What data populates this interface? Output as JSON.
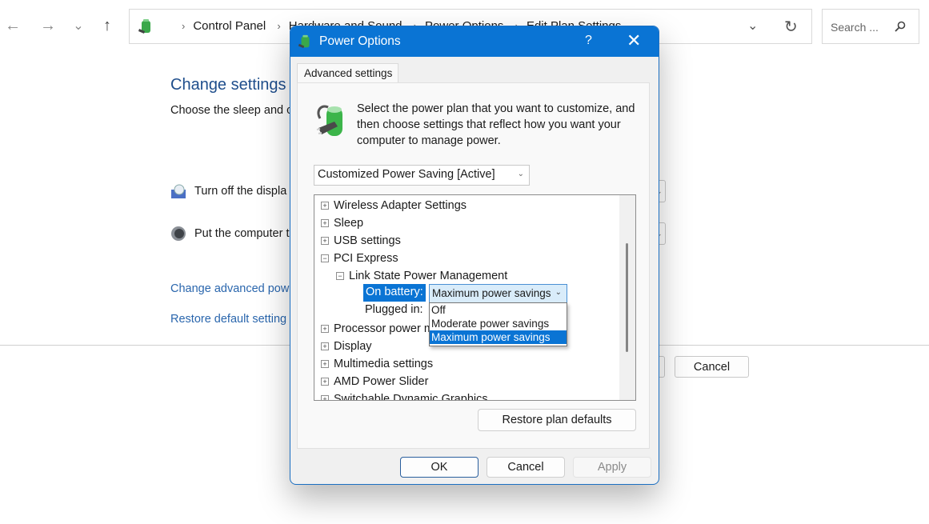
{
  "explorer": {
    "nav": {
      "back_icon": "←",
      "forward_icon": "→",
      "recent_icon": "⌄",
      "up_icon": "↑"
    },
    "breadcrumb": [
      "Control Panel",
      "Hardware and Sound",
      "Power Options",
      "Edit Plan Settings"
    ],
    "search_placeholder": "Search ...",
    "refresh_icon": "↻",
    "dropdown_icon": "⌄"
  },
  "page": {
    "title": "Change settings f",
    "subtitle": "Choose the sleep and c",
    "rows": [
      {
        "label": "Turn off the displa"
      },
      {
        "label": "Put the computer t"
      }
    ],
    "links": [
      "Change advanced pow",
      "Restore default setting"
    ],
    "cancel_label": "Cancel"
  },
  "dialog": {
    "title": "Power Options",
    "help_label": "?",
    "close_label": "✕",
    "tab_label": "Advanced settings",
    "description": "Select the power plan that you want to customize, and then choose settings that reflect how you want your computer to manage power.",
    "plan_select_value": "Customized Power Saving [Active]",
    "tree": {
      "items": [
        {
          "label": "Wireless Adapter Settings",
          "state": "+"
        },
        {
          "label": "Sleep",
          "state": "+"
        },
        {
          "label": "USB settings",
          "state": "+"
        },
        {
          "label": "PCI Express",
          "state": "−"
        },
        {
          "label": "Link State Power Management",
          "state": "−"
        },
        {
          "label": "Processor power management",
          "state": "+"
        },
        {
          "label": "Display",
          "state": "+"
        },
        {
          "label": "Multimedia settings",
          "state": "+"
        },
        {
          "label": "AMD Power Slider",
          "state": "+"
        },
        {
          "label": "Switchable Dynamic Graphics",
          "state": "+"
        }
      ],
      "on_battery_label": "On battery:",
      "on_battery_value": "Maximum power savings",
      "plugged_in_label": "Plugged in:",
      "options": [
        "Off",
        "Moderate power savings",
        "Maximum power savings"
      ],
      "selected_option": "Maximum power savings"
    },
    "restore_label": "Restore plan defaults",
    "ok_label": "OK",
    "cancel_label": "Cancel",
    "apply_label": "Apply"
  },
  "colors": {
    "accent": "#0a74d4",
    "link": "#2a66ad",
    "heading": "#1f4e8c"
  }
}
